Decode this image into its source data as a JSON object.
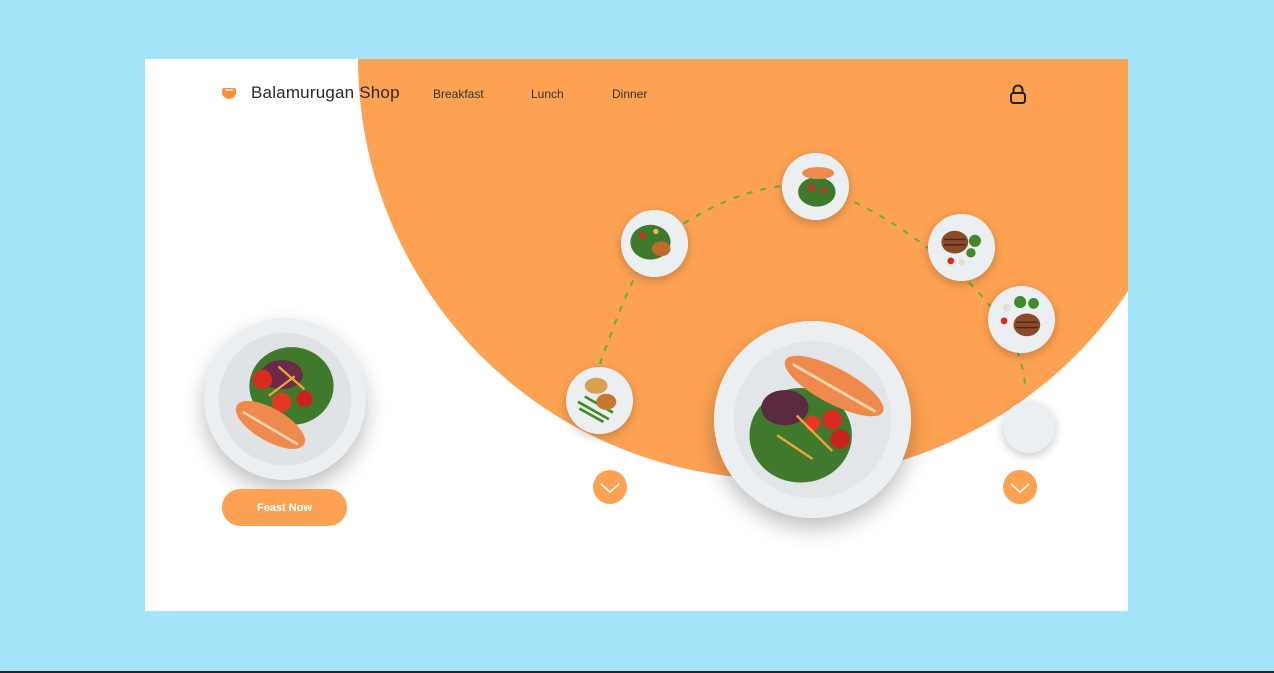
{
  "header": {
    "brand": "Balamurugan Shop",
    "logo_icon": "shield-logo-icon",
    "nav": [
      "Breakfast",
      "Lunch",
      "Dinner"
    ],
    "cart_icon": "lock-icon"
  },
  "hero": {
    "cta_label": "Feast Now",
    "plates": [
      "salmon-salad",
      "chicken-salad",
      "salmon-salad",
      "steak-broccoli",
      "steak-broccoli",
      "chicken-beans-rice"
    ],
    "prev_icon": "chevron-down-icon",
    "next_icon": "chevron-down-icon"
  },
  "colors": {
    "background": "#a4e4f8",
    "accent": "#fda252",
    "card": "#ffffff",
    "path": "#5fb13a"
  }
}
